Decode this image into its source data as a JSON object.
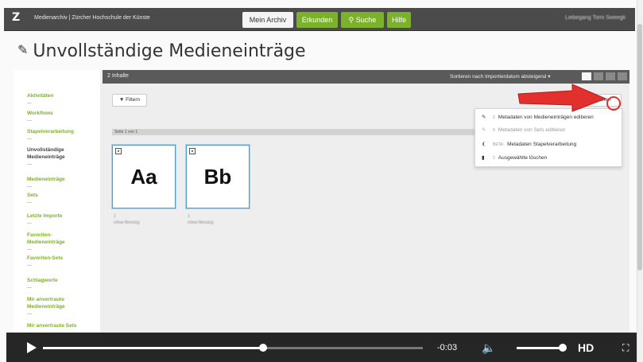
{
  "topbar": {
    "logo": "Z",
    "site_name": "Medienarchiv | Zürcher Hochschule der Künste",
    "nav": [
      "Mein Archiv",
      "Erkunden",
      "Suche",
      "Hilfe"
    ],
    "user": "Liebegang Tomi Sweegli"
  },
  "page": {
    "title": "Unvollständige Medieneinträge"
  },
  "sidebar": {
    "items": [
      "Aktivitäten",
      "Workflows",
      "Stapelverarbeitung",
      "Unvollständige\nMedieneinträge",
      "Medieneinträge",
      "Sets",
      "Letzte Importe",
      "Favoriten-\nMedieneinträge",
      "Favoriten-Sets",
      "Schlagworte",
      "Mir anvertraute\nMedieneinträge",
      "Mir anvertraute Sets"
    ]
  },
  "content": {
    "count": "2 Inhalte",
    "sort": "Sortieren nach Importierdatum absteigend ▾",
    "filter": "Filtern",
    "actions": "Aktionen",
    "page_label": "Seite 1 von 1",
    "items": [
      {
        "thumb": "Aa",
        "meta1": "1",
        "meta2": "rohue Benutzg"
      },
      {
        "thumb": "Bb",
        "meta1": "1",
        "meta2": "rohue Benutzg"
      }
    ]
  },
  "actions_menu": [
    {
      "num": "2",
      "label": "Metadaten von Medieneinträgen editieren",
      "enabled": true
    },
    {
      "num": "0",
      "label": "Metadaten von Sets editieren",
      "enabled": false
    },
    {
      "num": "BETA:",
      "label": "Metadaten Stapelverarbeitung",
      "enabled": true
    },
    {
      "num": "2",
      "label": "Ausgewählte löschen",
      "enabled": true
    }
  ],
  "video": {
    "time": "-0:03",
    "quality": "HD",
    "progress": 0.58,
    "volume": 0.95
  },
  "colors": {
    "accent": "#7cb12b",
    "annotation": "#e2302d"
  }
}
